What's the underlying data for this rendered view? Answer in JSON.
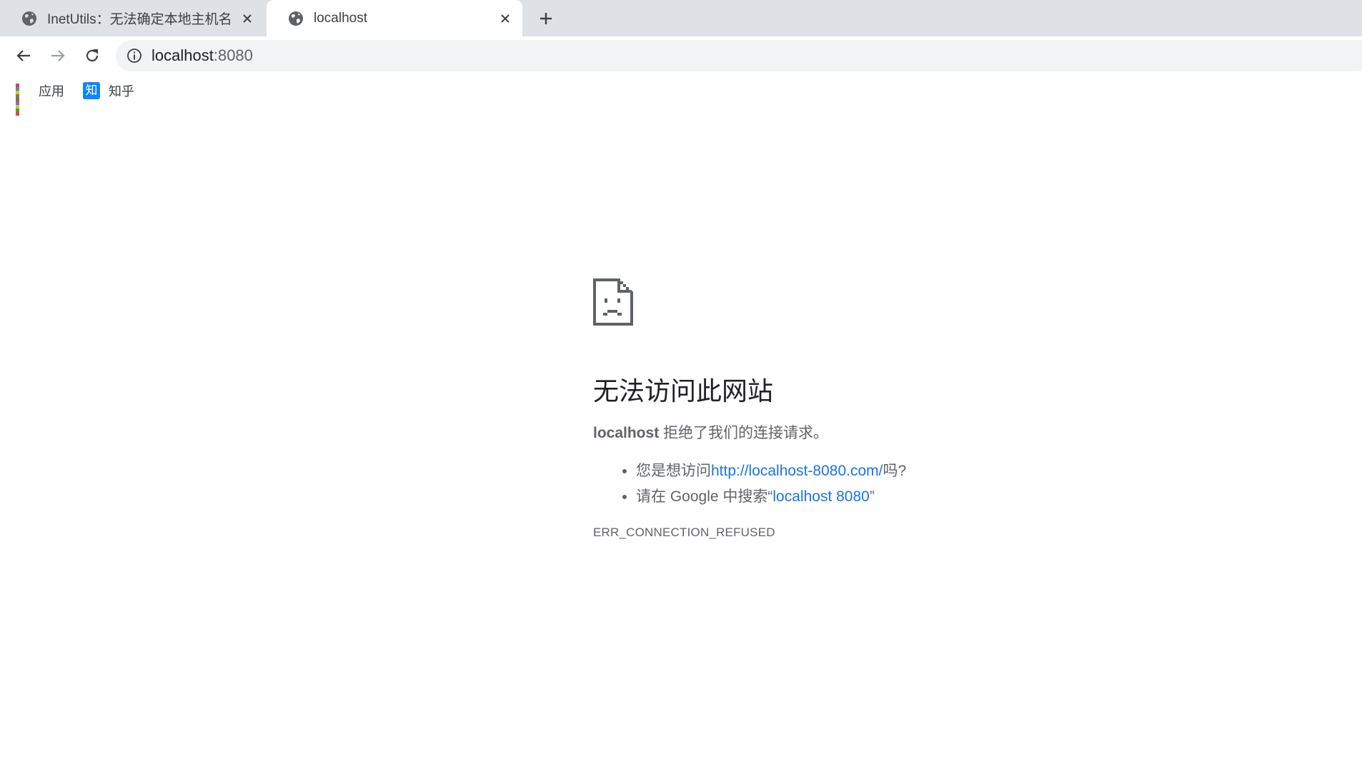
{
  "tabs": [
    {
      "title": "InetUtils：无法确定本地主机名",
      "icon": "globe-icon",
      "active": false
    },
    {
      "title": "localhost",
      "icon": "globe-icon",
      "active": true
    }
  ],
  "toolbar": {
    "url_host": "localhost",
    "url_port": ":8080"
  },
  "bookmarks": [
    {
      "label": "应用",
      "icon": "apps-grid-icon"
    },
    {
      "label": "知乎",
      "icon": "zhihu-icon",
      "icon_text": "知"
    }
  ],
  "error": {
    "title": "无法访问此网站",
    "host": "localhost",
    "message": " 拒绝了我们的连接请求。",
    "suggestion1_prefix": "您是想访问",
    "suggestion1_link": "http://localhost-8080.com/",
    "suggestion1_suffix": "吗?",
    "suggestion2_prefix": "请在 Google 中搜索“",
    "suggestion2_link": "localhost 8080",
    "suggestion2_suffix": "”",
    "code": "ERR_CONNECTION_REFUSED"
  },
  "colors": {
    "tabstrip_bg": "#dee1e6",
    "link": "#1a73e8",
    "text_secondary": "#5f6368",
    "zhihu_blue": "#0e84ff"
  }
}
